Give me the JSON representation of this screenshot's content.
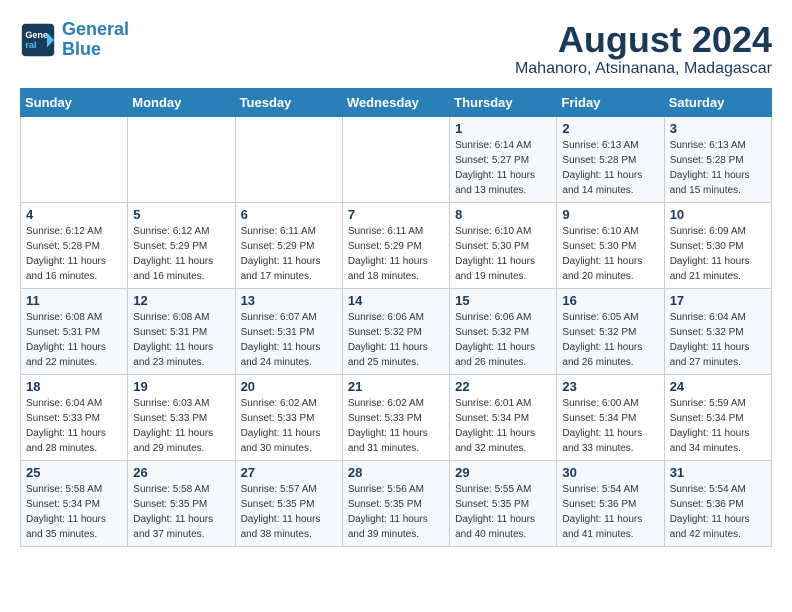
{
  "header": {
    "title": "August 2024",
    "subtitle": "Mahanoro, Atsinanana, Madagascar",
    "logo_general": "General",
    "logo_blue": "Blue"
  },
  "days_of_week": [
    "Sunday",
    "Monday",
    "Tuesday",
    "Wednesday",
    "Thursday",
    "Friday",
    "Saturday"
  ],
  "weeks": [
    [
      {
        "day": "",
        "info": ""
      },
      {
        "day": "",
        "info": ""
      },
      {
        "day": "",
        "info": ""
      },
      {
        "day": "",
        "info": ""
      },
      {
        "day": "1",
        "info": "Sunrise: 6:14 AM\nSunset: 5:27 PM\nDaylight: 11 hours\nand 13 minutes."
      },
      {
        "day": "2",
        "info": "Sunrise: 6:13 AM\nSunset: 5:28 PM\nDaylight: 11 hours\nand 14 minutes."
      },
      {
        "day": "3",
        "info": "Sunrise: 6:13 AM\nSunset: 5:28 PM\nDaylight: 11 hours\nand 15 minutes."
      }
    ],
    [
      {
        "day": "4",
        "info": "Sunrise: 6:12 AM\nSunset: 5:28 PM\nDaylight: 11 hours\nand 16 minutes."
      },
      {
        "day": "5",
        "info": "Sunrise: 6:12 AM\nSunset: 5:29 PM\nDaylight: 11 hours\nand 16 minutes."
      },
      {
        "day": "6",
        "info": "Sunrise: 6:11 AM\nSunset: 5:29 PM\nDaylight: 11 hours\nand 17 minutes."
      },
      {
        "day": "7",
        "info": "Sunrise: 6:11 AM\nSunset: 5:29 PM\nDaylight: 11 hours\nand 18 minutes."
      },
      {
        "day": "8",
        "info": "Sunrise: 6:10 AM\nSunset: 5:30 PM\nDaylight: 11 hours\nand 19 minutes."
      },
      {
        "day": "9",
        "info": "Sunrise: 6:10 AM\nSunset: 5:30 PM\nDaylight: 11 hours\nand 20 minutes."
      },
      {
        "day": "10",
        "info": "Sunrise: 6:09 AM\nSunset: 5:30 PM\nDaylight: 11 hours\nand 21 minutes."
      }
    ],
    [
      {
        "day": "11",
        "info": "Sunrise: 6:08 AM\nSunset: 5:31 PM\nDaylight: 11 hours\nand 22 minutes."
      },
      {
        "day": "12",
        "info": "Sunrise: 6:08 AM\nSunset: 5:31 PM\nDaylight: 11 hours\nand 23 minutes."
      },
      {
        "day": "13",
        "info": "Sunrise: 6:07 AM\nSunset: 5:31 PM\nDaylight: 11 hours\nand 24 minutes."
      },
      {
        "day": "14",
        "info": "Sunrise: 6:06 AM\nSunset: 5:32 PM\nDaylight: 11 hours\nand 25 minutes."
      },
      {
        "day": "15",
        "info": "Sunrise: 6:06 AM\nSunset: 5:32 PM\nDaylight: 11 hours\nand 26 minutes."
      },
      {
        "day": "16",
        "info": "Sunrise: 6:05 AM\nSunset: 5:32 PM\nDaylight: 11 hours\nand 26 minutes."
      },
      {
        "day": "17",
        "info": "Sunrise: 6:04 AM\nSunset: 5:32 PM\nDaylight: 11 hours\nand 27 minutes."
      }
    ],
    [
      {
        "day": "18",
        "info": "Sunrise: 6:04 AM\nSunset: 5:33 PM\nDaylight: 11 hours\nand 28 minutes."
      },
      {
        "day": "19",
        "info": "Sunrise: 6:03 AM\nSunset: 5:33 PM\nDaylight: 11 hours\nand 29 minutes."
      },
      {
        "day": "20",
        "info": "Sunrise: 6:02 AM\nSunset: 5:33 PM\nDaylight: 11 hours\nand 30 minutes."
      },
      {
        "day": "21",
        "info": "Sunrise: 6:02 AM\nSunset: 5:33 PM\nDaylight: 11 hours\nand 31 minutes."
      },
      {
        "day": "22",
        "info": "Sunrise: 6:01 AM\nSunset: 5:34 PM\nDaylight: 11 hours\nand 32 minutes."
      },
      {
        "day": "23",
        "info": "Sunrise: 6:00 AM\nSunset: 5:34 PM\nDaylight: 11 hours\nand 33 minutes."
      },
      {
        "day": "24",
        "info": "Sunrise: 5:59 AM\nSunset: 5:34 PM\nDaylight: 11 hours\nand 34 minutes."
      }
    ],
    [
      {
        "day": "25",
        "info": "Sunrise: 5:58 AM\nSunset: 5:34 PM\nDaylight: 11 hours\nand 35 minutes."
      },
      {
        "day": "26",
        "info": "Sunrise: 5:58 AM\nSunset: 5:35 PM\nDaylight: 11 hours\nand 37 minutes."
      },
      {
        "day": "27",
        "info": "Sunrise: 5:57 AM\nSunset: 5:35 PM\nDaylight: 11 hours\nand 38 minutes."
      },
      {
        "day": "28",
        "info": "Sunrise: 5:56 AM\nSunset: 5:35 PM\nDaylight: 11 hours\nand 39 minutes."
      },
      {
        "day": "29",
        "info": "Sunrise: 5:55 AM\nSunset: 5:35 PM\nDaylight: 11 hours\nand 40 minutes."
      },
      {
        "day": "30",
        "info": "Sunrise: 5:54 AM\nSunset: 5:36 PM\nDaylight: 11 hours\nand 41 minutes."
      },
      {
        "day": "31",
        "info": "Sunrise: 5:54 AM\nSunset: 5:36 PM\nDaylight: 11 hours\nand 42 minutes."
      }
    ]
  ]
}
